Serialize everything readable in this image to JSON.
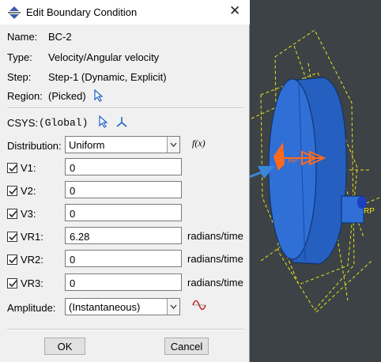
{
  "dialog": {
    "title": "Edit Boundary Condition",
    "close_symbol": "✕",
    "info": [
      {
        "key": "Name:",
        "value": "BC-2"
      },
      {
        "key": "Type:",
        "value": "Velocity/Angular velocity"
      },
      {
        "key": "Step:",
        "value": "Step-1 (Dynamic, Explicit)"
      },
      {
        "key": "Region:",
        "value": "(Picked)"
      }
    ],
    "csys_label": "CSYS:",
    "csys_value": "(Global)",
    "distribution_label": "Distribution:",
    "distribution_value": "Uniform",
    "fx_label": "f(x)",
    "components": [
      {
        "label": "V1:",
        "value": "0",
        "unit": "",
        "checked": true
      },
      {
        "label": "V2:",
        "value": "0",
        "unit": "",
        "checked": true
      },
      {
        "label": "V3:",
        "value": "0",
        "unit": "",
        "checked": true
      },
      {
        "label": "VR1:",
        "value": "6.28",
        "unit": "radians/time",
        "checked": true
      },
      {
        "label": "VR2:",
        "value": "0",
        "unit": "radians/time",
        "checked": true
      },
      {
        "label": "VR3:",
        "value": "0",
        "unit": "radians/time",
        "checked": true
      }
    ],
    "amplitude_label": "Amplitude:",
    "amplitude_value": "(Instantaneous)",
    "ok_label": "OK",
    "cancel_label": "Cancel"
  },
  "icons": [
    "boundary-condition-icon",
    "close-icon",
    "pick-arrow-icon",
    "csys-axis-icon",
    "function-fx-icon",
    "chevron-down-icon",
    "amplitude-wave-icon",
    "checkbox-check-icon"
  ],
  "colors": {
    "viewport_bg": "#3d4246",
    "part_blue": "#2f6fd6",
    "annotation_arrow": "#3a86d8",
    "load_arrow": "#ff6a1a",
    "outline_yellow": "#e6e61a"
  }
}
